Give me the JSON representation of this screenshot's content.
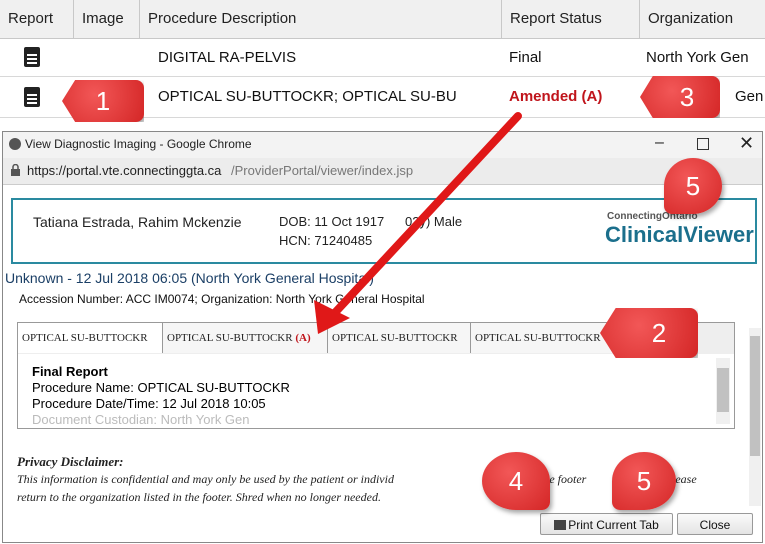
{
  "table": {
    "headers": [
      "Report",
      "Image",
      "Procedure Description",
      "Report Status",
      "Organization"
    ],
    "rows": [
      {
        "procedure": "DIGITAL RA-PELVIS",
        "status": "Final",
        "org": "North York Gen"
      },
      {
        "procedure": "OPTICAL SU-BUTTOCKR; OPTICAL SU-BU",
        "status": "Amended (A)",
        "org": "Gen"
      }
    ]
  },
  "window": {
    "title": "View Diagnostic Imaging - Google Chrome",
    "url_host": "https://portal.vte.connectinggta.ca",
    "url_path": "/ProviderPortal/viewer/index.jsp",
    "patient_names": "Tatiana Estrada, Rahim Mckenzie",
    "dob": "DOB: 11 Oct 1917",
    "age_sex": "02y) Male",
    "hcn": "HCN: 71240485",
    "brand_top": "ConnectingOntario",
    "brand_main": "ClinicalViewer",
    "study_title": "Unknown - 12 Jul 2018 06:05 (North York General Hospital)",
    "accession": "Accession Number: ACC IM0074; Organization: North York General Hospital",
    "tabs": [
      "OPTICAL SU-BUTTOCKR",
      "OPTICAL SU-BUTTOCKR",
      "OPTICAL SU-BUTTOCKR",
      "OPTICAL SU-BUTTOCKR"
    ],
    "amend_mark": "(A)",
    "report_heading": "Final Report",
    "procedure_name": "Procedure Name: OPTICAL SU-BUTTOCKR",
    "procedure_date": "Procedure Date/Time: 12 Jul 2018 10:05",
    "document_custodian": "Document Custodian: North York Gen",
    "privacy_title": "Privacy Disclaimer:",
    "privacy_line1": "This information is confidential and may only be used by the patient or individ",
    "privacy_line1_tail": "n the footer",
    "privacy_line1_end": "please",
    "privacy_line2": "return to the organization listed in the footer. Shred when no longer needed.",
    "print_label": "Print Current Tab",
    "close_label": "Close"
  },
  "callouts": [
    "1",
    "3",
    "5",
    "2",
    "4",
    "5"
  ],
  "colors": {
    "callout": "#d93434",
    "amended": "#c0141b",
    "border": "#2a8aa0",
    "brand": "#1b6f8c"
  }
}
